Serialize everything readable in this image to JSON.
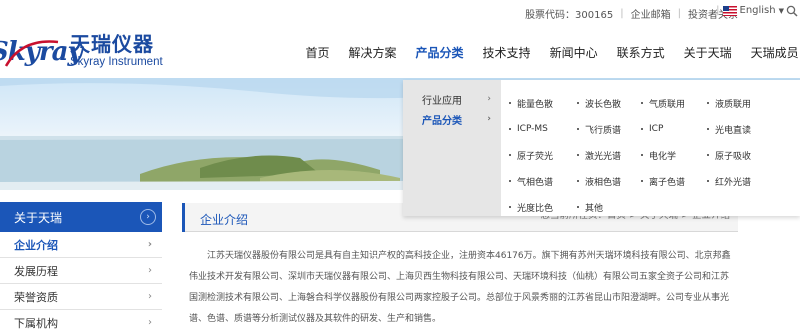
{
  "topbar": {
    "stock_code": "股票代码：300165",
    "mailbox": "企业邮箱",
    "investor": "投资者关系",
    "language": "English"
  },
  "logo": {
    "script": "Skyray",
    "name_cn": "天瑞仪器",
    "name_en": "Skyray Instrument"
  },
  "nav": {
    "items": [
      "首页",
      "解决方案",
      "产品分类",
      "技术支持",
      "新闻中心",
      "联系方式",
      "关于天瑞",
      "天瑞成员"
    ],
    "active_index": 2
  },
  "dropdown": {
    "categories": [
      {
        "label": "行业应用",
        "arrow": "›"
      },
      {
        "label": "产品分类",
        "arrow": "›"
      }
    ],
    "products": [
      "能量色散",
      "波长色散",
      "气质联用",
      "液质联用",
      "ICP-MS",
      "飞行质谱",
      "ICP",
      "光电直读",
      "原子荧光",
      "激光光谱",
      "电化学",
      "原子吸收",
      "气相色谱",
      "液相色谱",
      "离子色谱",
      "红外光谱",
      "光度比色",
      "其他"
    ]
  },
  "sidebar": {
    "header": "关于天瑞",
    "items": [
      "企业介绍",
      "发展历程",
      "荣誉资质",
      "下属机构"
    ]
  },
  "content": {
    "title": "企业介绍",
    "breadcrumb": "您当前所在页：首页 > 关于天瑞 > 企业介绍",
    "paragraph": "江苏天瑞仪器股份有限公司是具有自主知识产权的高科技企业，注册资本46176万。旗下拥有苏州天瑞环境科技有限公司、北京邦鑫伟业技术开发有限公司、深圳市天瑞仪器有限公司、上海贝西生物科技有限公司、天瑞环境科技（仙桃）有限公司五家全资子公司和江苏国测检测技术有限公司、上海磐合科学仪器股份有限公司两家控股子公司。总部位于风景秀丽的江苏省昆山市阳澄湖畔。公司专业从事光谱、色谱、质谱等分析测试仪器及其软件的研发、生产和销售。"
  },
  "colors": {
    "brand_blue": "#1b56b8",
    "dropdown_gray": "#e6e6e6"
  }
}
